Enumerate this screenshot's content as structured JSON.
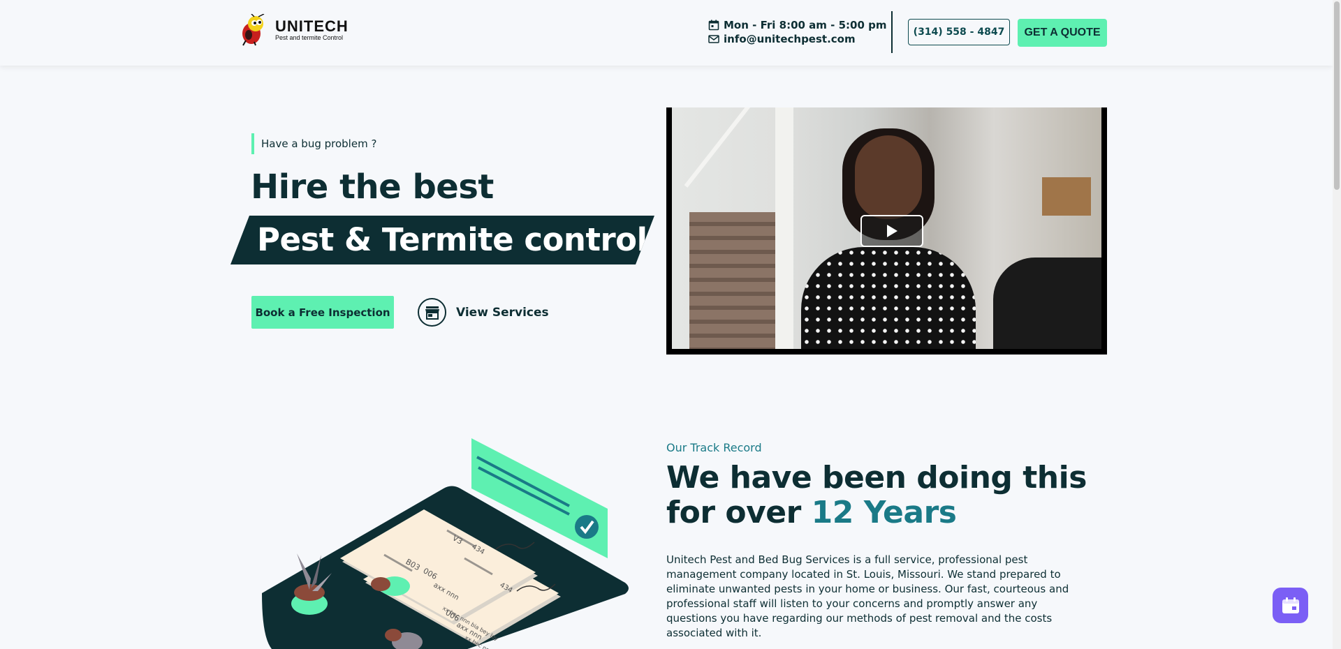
{
  "header": {
    "logo_name": "UNITECH",
    "logo_tagline": "Pest and termite Control",
    "hours": "Mon - Fri 8:00 am - 5:00 pm",
    "email": "info@unitechpest.com",
    "phone": "(314) 558 - 4847",
    "quote_label": "GET A QUOTE"
  },
  "hero": {
    "eyebrow": "Have a bug problem ?",
    "title_line1": "Hire the best",
    "title_line2": "Pest & Termite control.",
    "book_label": "Book a Free Inspection",
    "services_label": "View Services"
  },
  "track": {
    "label": "Our Track Record",
    "title_start": "We have been doing this for over",
    "title_accent": "12 Years",
    "body": "Unitech Pest and Bed Bug Services is a full service, professional pest management company located in St. Louis, Missouri. We stand prepared to eliminate unwanted pests in your home or business. Our fast, courteous and professional staff will listen to your concerns and promptly answer any questions you have regarding our methods of pest removal and the costs associated with it."
  },
  "illustration_card_text": {
    "card_a": [
      "V3",
      "434",
      "B03",
      "006",
      "axx nnn",
      "xx bec nnn bia bey loy"
    ],
    "card_b": [
      "434",
      "006",
      "axx nnn",
      "xx bec nnn bia bey loy"
    ]
  },
  "colors": {
    "accent_green": "#5ef0b1",
    "dark_teal": "#0d2e33",
    "teal": "#1a7a87",
    "fab_purple": "#7b5ff5"
  }
}
